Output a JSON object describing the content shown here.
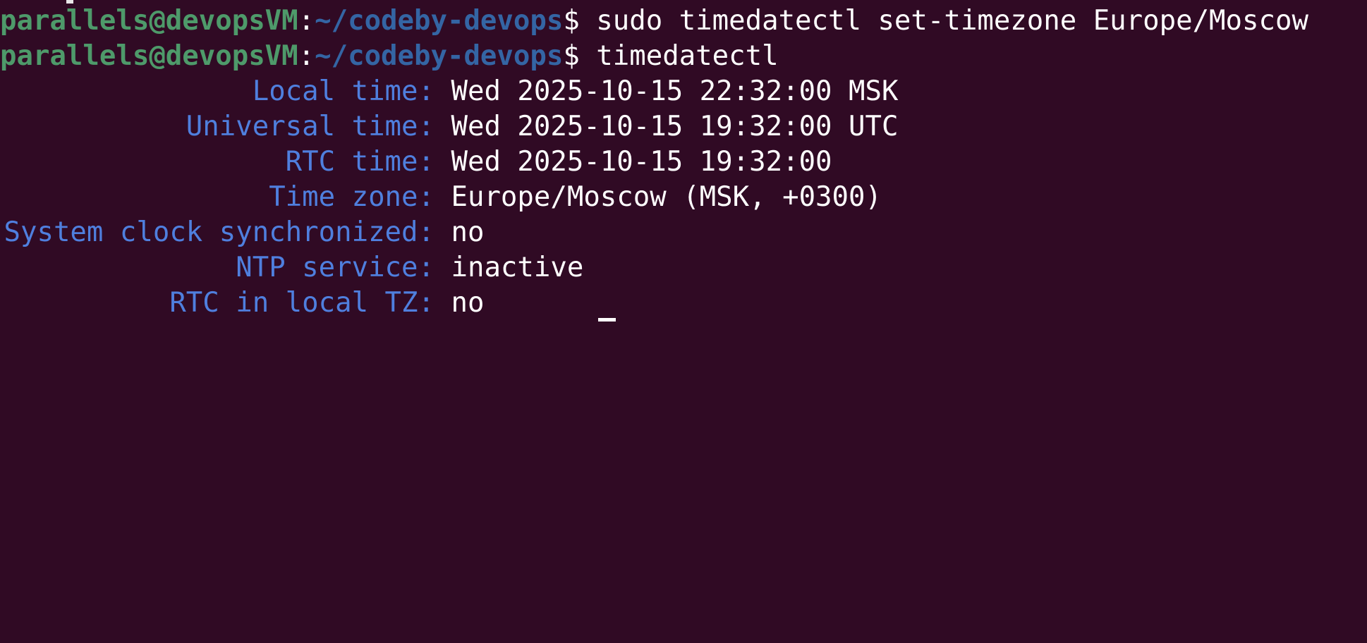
{
  "prompt": {
    "user_host": "parallels@devopsVM",
    "colon": ":",
    "path": "~/codeby-devops",
    "dollar": "$"
  },
  "commands": [
    "sudo timedatectl set-timezone Europe/Moscow",
    "timedatectl"
  ],
  "output": [
    {
      "label": "Local time:",
      "value": "Wed 2025-10-15 22:32:00 MSK"
    },
    {
      "label": "Universal time:",
      "value": "Wed 2025-10-15 19:32:00 UTC"
    },
    {
      "label": "RTC time:",
      "value": "Wed 2025-10-15 19:32:00"
    },
    {
      "label": "Time zone:",
      "value": "Europe/Moscow (MSK, +0300)"
    },
    {
      "label": "System clock synchronized:",
      "value": "no"
    },
    {
      "label": "NTP service:",
      "value": "inactive"
    },
    {
      "label": "RTC in local TZ:",
      "value": "no"
    }
  ]
}
